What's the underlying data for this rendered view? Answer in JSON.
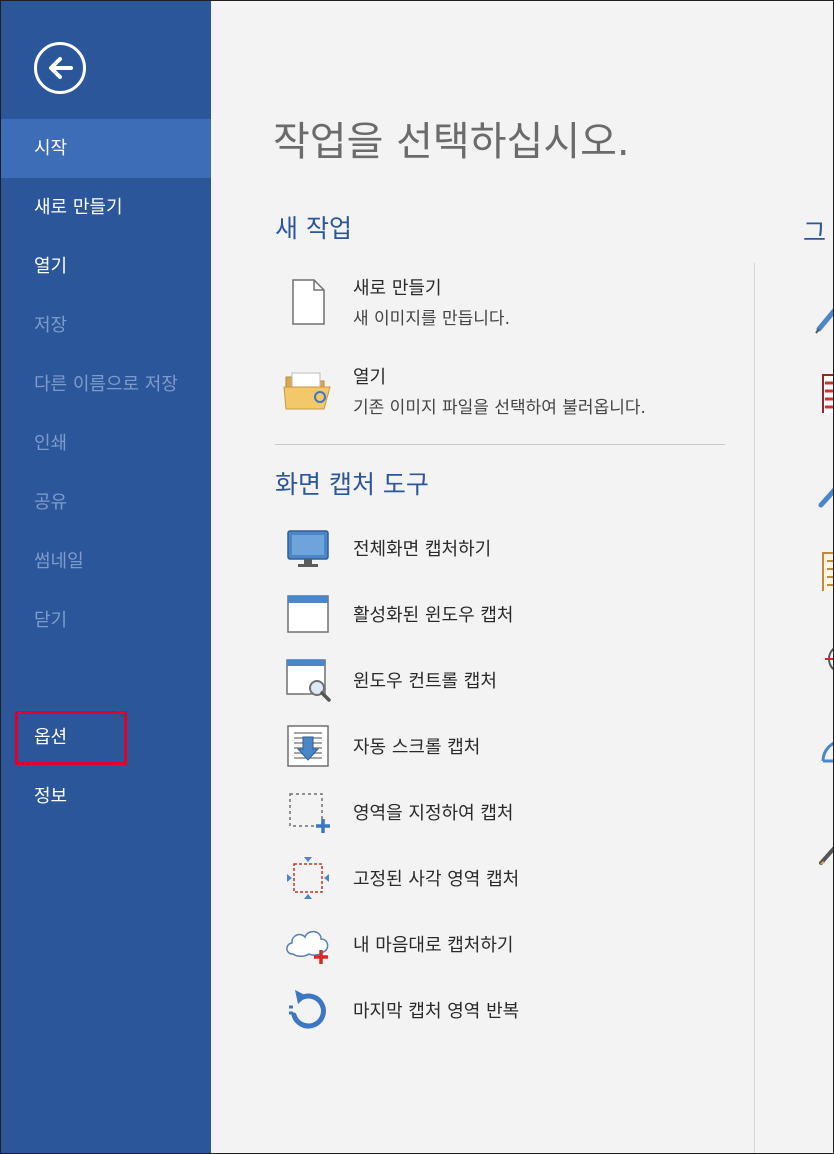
{
  "sidebar": {
    "back_icon": "arrow-left-circle-icon",
    "items": [
      {
        "label": "시작",
        "state": "active"
      },
      {
        "label": "새로 만들기",
        "state": "enabled"
      },
      {
        "label": "열기",
        "state": "enabled"
      },
      {
        "label": "저장",
        "state": "disabled"
      },
      {
        "label": "다른 이름으로 저장",
        "state": "disabled"
      },
      {
        "label": "인쇄",
        "state": "disabled"
      },
      {
        "label": "공유",
        "state": "disabled"
      },
      {
        "label": "썸네일",
        "state": "disabled"
      },
      {
        "label": "닫기",
        "state": "disabled"
      },
      {
        "label": "옵션",
        "state": "enabled"
      },
      {
        "label": "정보",
        "state": "enabled"
      }
    ],
    "highlighted_item": "옵션"
  },
  "main": {
    "title": "작업을 선택하십시오.",
    "new_task": {
      "heading": "새 작업",
      "items": [
        {
          "name": "새로 만들기",
          "desc": "새 이미지를 만듭니다.",
          "icon": "blank-document-icon"
        },
        {
          "name": "열기",
          "desc": "기존 이미지 파일을 선택하여 불러옵니다.",
          "icon": "open-folder-icon"
        }
      ]
    },
    "capture": {
      "heading": "화면 캡처 도구",
      "items": [
        {
          "name": "전체화면 캡처하기",
          "icon": "monitor-icon"
        },
        {
          "name": "활성화된 윈도우 캡처",
          "icon": "active-window-icon"
        },
        {
          "name": "윈도우 컨트롤 캡처",
          "icon": "window-magnifier-icon"
        },
        {
          "name": "자동 스크롤 캡처",
          "icon": "scroll-capture-icon"
        },
        {
          "name": "영역을 지정하여 캡처",
          "icon": "region-select-icon"
        },
        {
          "name": "고정된 사각 영역 캡처",
          "icon": "fixed-rectangle-icon"
        },
        {
          "name": "내 마음대로 캡처하기",
          "icon": "freeform-cloud-icon"
        },
        {
          "name": "마지막 캡처 영역 반복",
          "icon": "repeat-arrow-icon"
        }
      ]
    },
    "right_section_peek": "그"
  },
  "colors": {
    "sidebar_bg": "#2b579a",
    "sidebar_active": "#3e6db8",
    "accent": "#2b579a",
    "highlight_border": "#e0002a",
    "content_bg": "#f3f3f3"
  }
}
